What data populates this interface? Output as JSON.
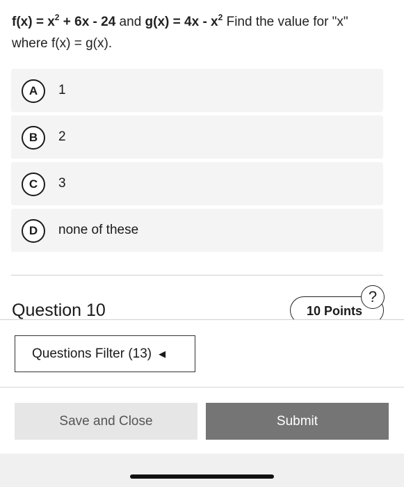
{
  "question": {
    "f_def": "f(x) = x",
    "f_exp": "2",
    "f_rest": " + 6x - 24",
    "and_word": " and ",
    "g_def": "g(x) = 4x - x",
    "g_exp": "2",
    "prompt": "  Find the value for \"x\" where f(x) = g(x)."
  },
  "options": [
    {
      "letter": "A",
      "label": "1"
    },
    {
      "letter": "B",
      "label": "2"
    },
    {
      "letter": "C",
      "label": "3"
    },
    {
      "letter": "D",
      "label": "none of these"
    }
  ],
  "next_question": {
    "title": "Question 10",
    "points": "10 Points",
    "help_icon": "question-mark-icon"
  },
  "footer": {
    "filter_label": "Questions Filter (13)",
    "filter_icon": "caret-left-icon",
    "save_label": "Save and Close",
    "submit_label": "Submit"
  }
}
